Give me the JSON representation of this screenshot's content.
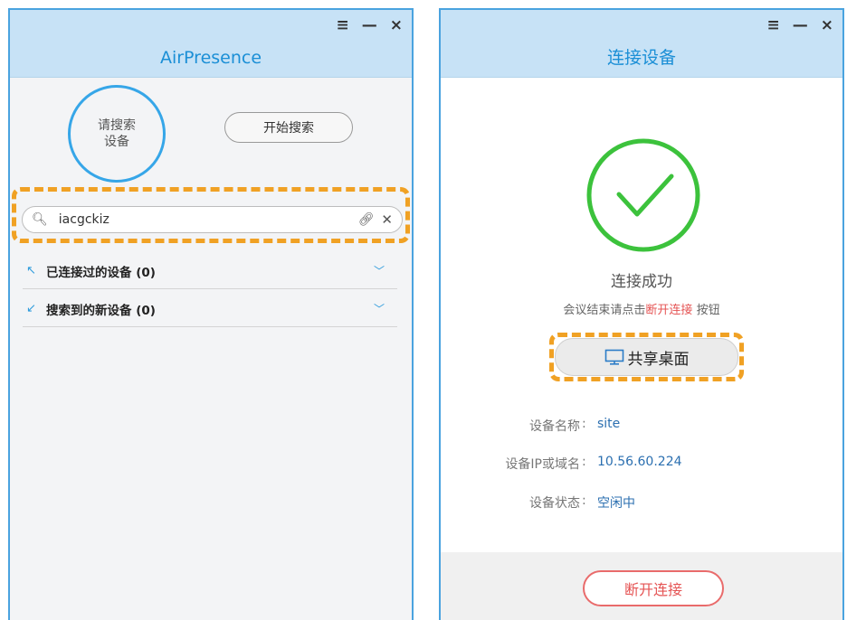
{
  "left_window": {
    "controls": {
      "menu": "≡",
      "minimize": "—",
      "close": "×"
    },
    "app_title": "AirPresence",
    "search_circle_text": "请搜索设备",
    "start_search_label": "开始搜索",
    "search_input_value": "iacgckiz",
    "sections": [
      {
        "icon": "connected-devices-icon",
        "label": "已连接过的设备 (0)"
      },
      {
        "icon": "new-devices-icon",
        "label": "搜索到的新设备 (0)"
      }
    ]
  },
  "right_window": {
    "controls": {
      "menu": "≡",
      "minimize": "—",
      "close": "×"
    },
    "title": "连接设备",
    "status_title": "连接成功",
    "status_sub_prefix": "会议结束请点击",
    "status_sub_highlight": "断开连接",
    "status_sub_suffix": "按钮",
    "share_desktop_label": "共享桌面",
    "device_info": [
      {
        "label": "设备名称",
        "value": "site"
      },
      {
        "label": "设备IP或域名",
        "value": "10.56.60.224"
      },
      {
        "label": "设备状态",
        "value": "空闲中"
      }
    ],
    "disconnect_label": "断开连接"
  },
  "colors": {
    "accent_blue": "#36a6e8",
    "success_green": "#3cc23c",
    "highlight_orange": "#f0a124",
    "danger_red": "#e55454"
  }
}
